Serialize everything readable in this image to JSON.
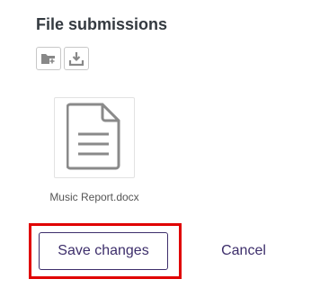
{
  "section": {
    "title": "File submissions"
  },
  "toolbar": {
    "buttons": [
      {
        "icon": "add-folder-icon"
      },
      {
        "icon": "download-icon"
      }
    ]
  },
  "files": [
    {
      "name": "Music Report.docx",
      "icon": "document-icon"
    }
  ],
  "actions": {
    "save_label": "Save changes",
    "cancel_label": "Cancel"
  },
  "colors": {
    "primary": "#3d2e6b",
    "highlight": "#e00000",
    "icon_gray": "#888888"
  }
}
